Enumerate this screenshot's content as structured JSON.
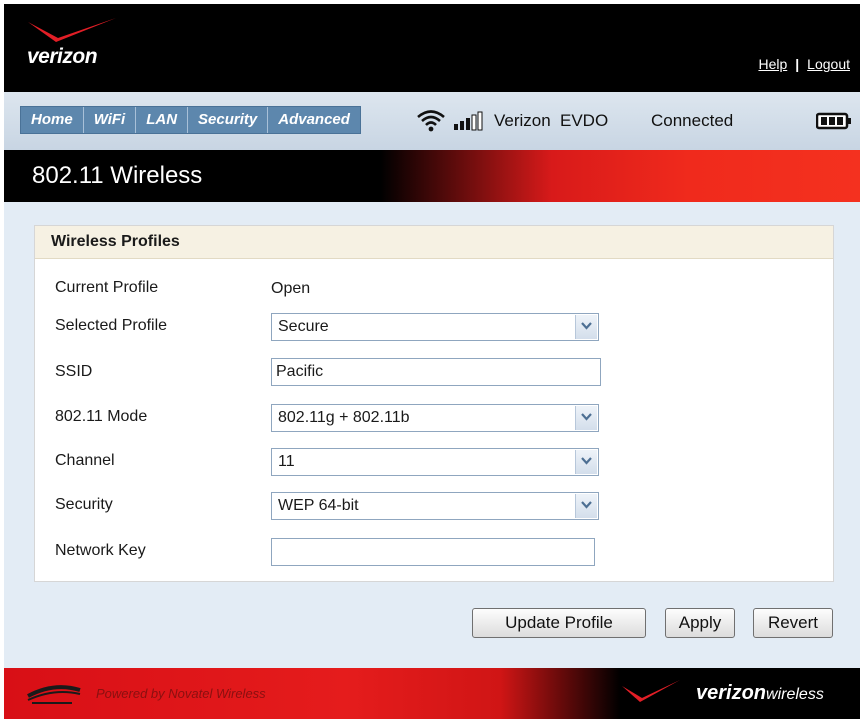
{
  "header": {
    "brand": "verizon",
    "help_link": "Help",
    "separator": "|",
    "logout_link": "Logout"
  },
  "nav": {
    "tabs": [
      "Home",
      "WiFi",
      "LAN",
      "Security",
      "Advanced"
    ],
    "network_name": "Verizon",
    "network_type": "EVDO",
    "connection_status": "Connected",
    "icons": [
      "wifi-icon",
      "signal-strength-icon",
      "battery-icon"
    ]
  },
  "page": {
    "title": "802.11 Wireless"
  },
  "panel": {
    "heading": "Wireless Profiles",
    "current_profile_label": "Current Profile",
    "current_profile_value": "Open",
    "selected_profile_label": "Selected Profile",
    "selected_profile_value": "Secure",
    "ssid_label": "SSID",
    "ssid_value": "Pacific",
    "mode_label": "802.11 Mode",
    "mode_value": "802.11g + 802.11b",
    "channel_label": "Channel",
    "channel_value": "11",
    "security_label": "Security",
    "security_value": "WEP 64-bit",
    "network_key_label": "Network Key",
    "network_key_value": ""
  },
  "buttons": {
    "update_profile": "Update Profile",
    "apply": "Apply",
    "revert": "Revert"
  },
  "footer": {
    "powered_by": "Powered by Novatel Wireless",
    "brand_bold": "verizon",
    "brand_suffix": "wireless"
  },
  "colors": {
    "brand_red": "#e51c1c",
    "tab_blue": "#5d87ad",
    "page_bg": "#e3ecf5",
    "panel_head_bg": "#f6f1e3"
  }
}
